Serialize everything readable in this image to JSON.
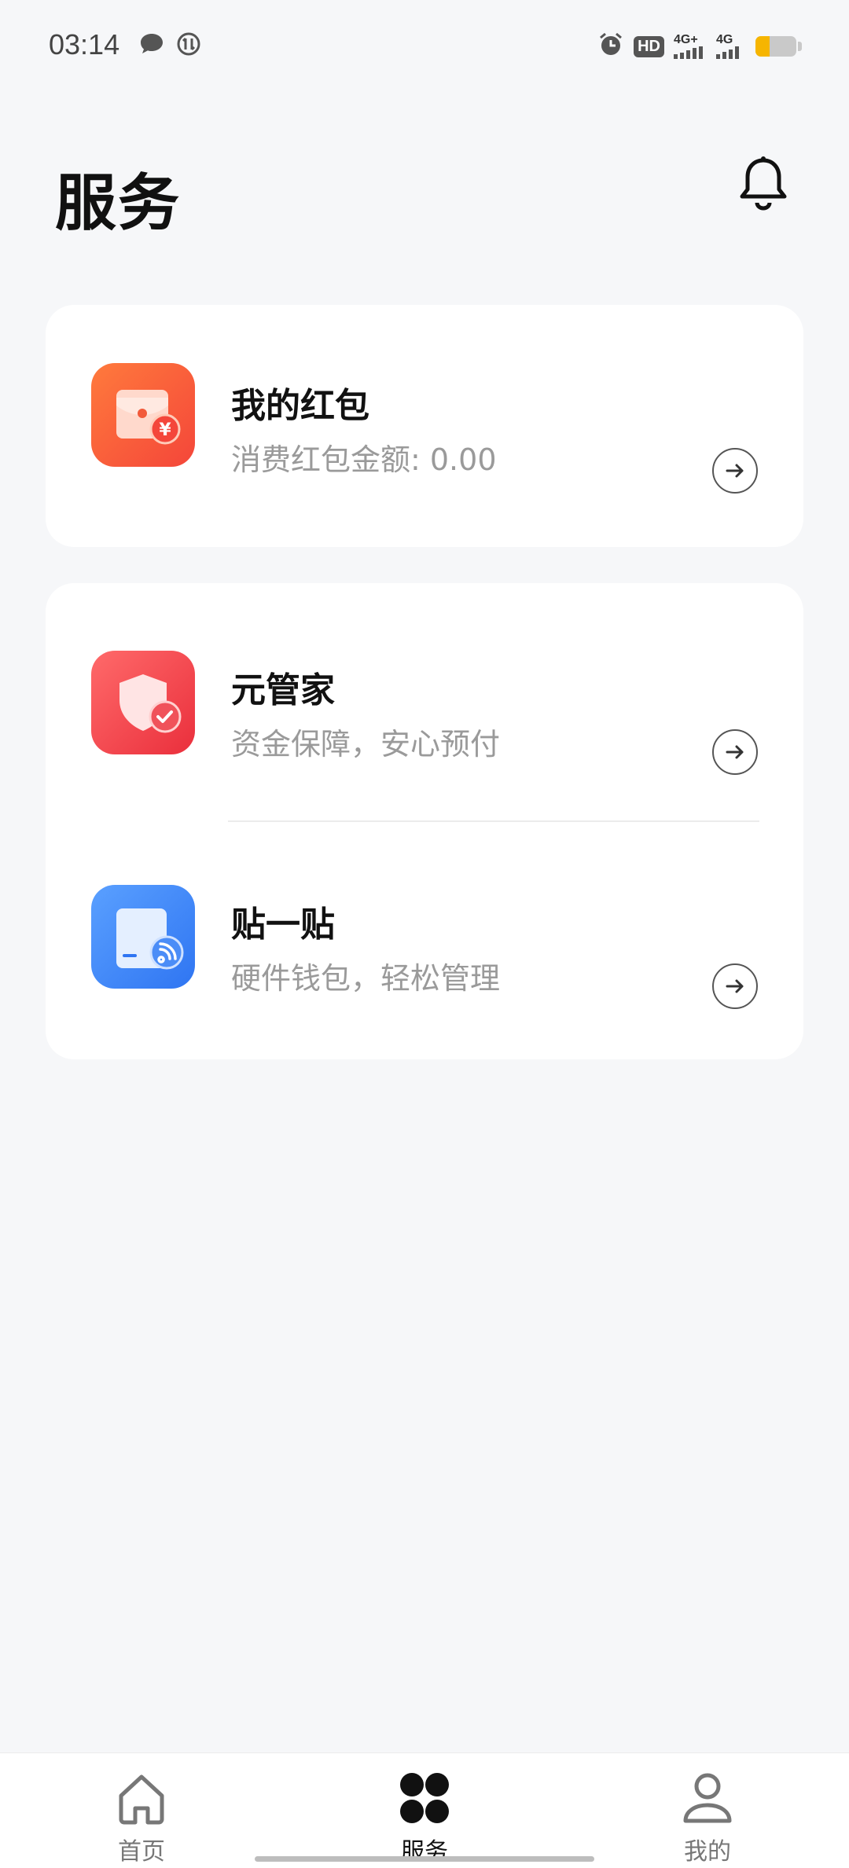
{
  "status_bar": {
    "time": "03:14",
    "hd_label": "HD",
    "net1_label": "4G+",
    "net2_label": "4G",
    "battery_level": 0.35,
    "icons": [
      "chat-bubble-icon",
      "data-saver-icon",
      "alarm-icon",
      "hd-icon",
      "signal-4g-plus-icon",
      "signal-4g-icon",
      "battery-icon"
    ]
  },
  "header": {
    "title": "服务",
    "icon": "bell-icon"
  },
  "cards": {
    "hongbao": {
      "title": "我的红包",
      "subtitle": "消费红包金额: 0.00",
      "icon": "red-envelope-icon",
      "color": "#f6553a"
    },
    "yuanguanjia": {
      "title": "元管家",
      "subtitle": "资金保障，安心预付",
      "icon": "shield-check-icon",
      "color": "#ef3f48"
    },
    "tieyitie": {
      "title": "贴一贴",
      "subtitle": "硬件钱包，轻松管理",
      "icon": "nfc-card-icon",
      "color": "#3d86ff"
    }
  },
  "nav": {
    "items": [
      {
        "label": "首页",
        "icon": "home-icon"
      },
      {
        "label": "服务",
        "icon": "grid-icon",
        "active": true
      },
      {
        "label": "我的",
        "icon": "person-icon"
      }
    ]
  }
}
